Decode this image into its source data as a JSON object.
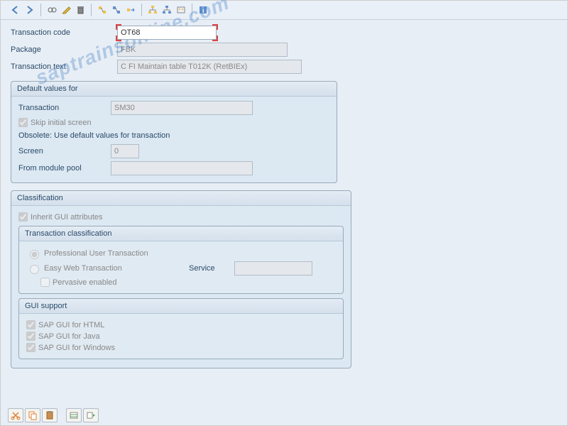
{
  "watermark": "saptrainsonline.com",
  "header": {
    "transaction_code_label": "Transaction code",
    "transaction_code_value": "OT68",
    "package_label": "Package",
    "package_value": "FBK",
    "transaction_text_label": "Transaction text",
    "transaction_text_value": "C FI Maintain table T012K (RetBIEx)"
  },
  "default_values": {
    "title": "Default values for",
    "transaction_label": "Transaction",
    "transaction_value": "SM30",
    "skip_initial_screen_label": "Skip initial screen",
    "skip_initial_screen_checked": true,
    "obsolete_text": "Obsolete: Use default values for transaction",
    "screen_label": "Screen",
    "screen_value": "0",
    "from_module_pool_label": "From module pool",
    "from_module_pool_value": ""
  },
  "classification": {
    "title": "Classification",
    "inherit_label": "Inherit GUI attributes",
    "inherit_checked": true,
    "trans_class": {
      "title": "Transaction classification",
      "professional_label": "Professional User Transaction",
      "professional_selected": true,
      "easy_web_label": "Easy Web Transaction",
      "easy_web_selected": false,
      "service_label": "Service",
      "service_value": "",
      "pervasive_label": "Pervasive enabled",
      "pervasive_checked": false
    },
    "gui_support": {
      "title": "GUI support",
      "html_label": "SAP GUI for HTML",
      "html_checked": true,
      "java_label": "SAP GUI for Java",
      "java_checked": true,
      "windows_label": "SAP GUI for Windows",
      "windows_checked": true
    }
  },
  "icons": {
    "back": "back-arrow-icon",
    "forward": "forward-arrow-icon",
    "glasses": "display-icon",
    "pencil": "edit-icon",
    "trash": "delete-icon",
    "node1": "find-icon",
    "node2": "find-next-icon",
    "node3": "other-object-icon",
    "struct1": "hierarchy-icon",
    "struct2": "assign-icon",
    "struct3": "where-used-icon",
    "info": "information-icon",
    "cut": "cut-icon",
    "copy": "copy-icon",
    "paste": "paste-icon",
    "list1": "variant-icon",
    "list2": "values-icon"
  }
}
